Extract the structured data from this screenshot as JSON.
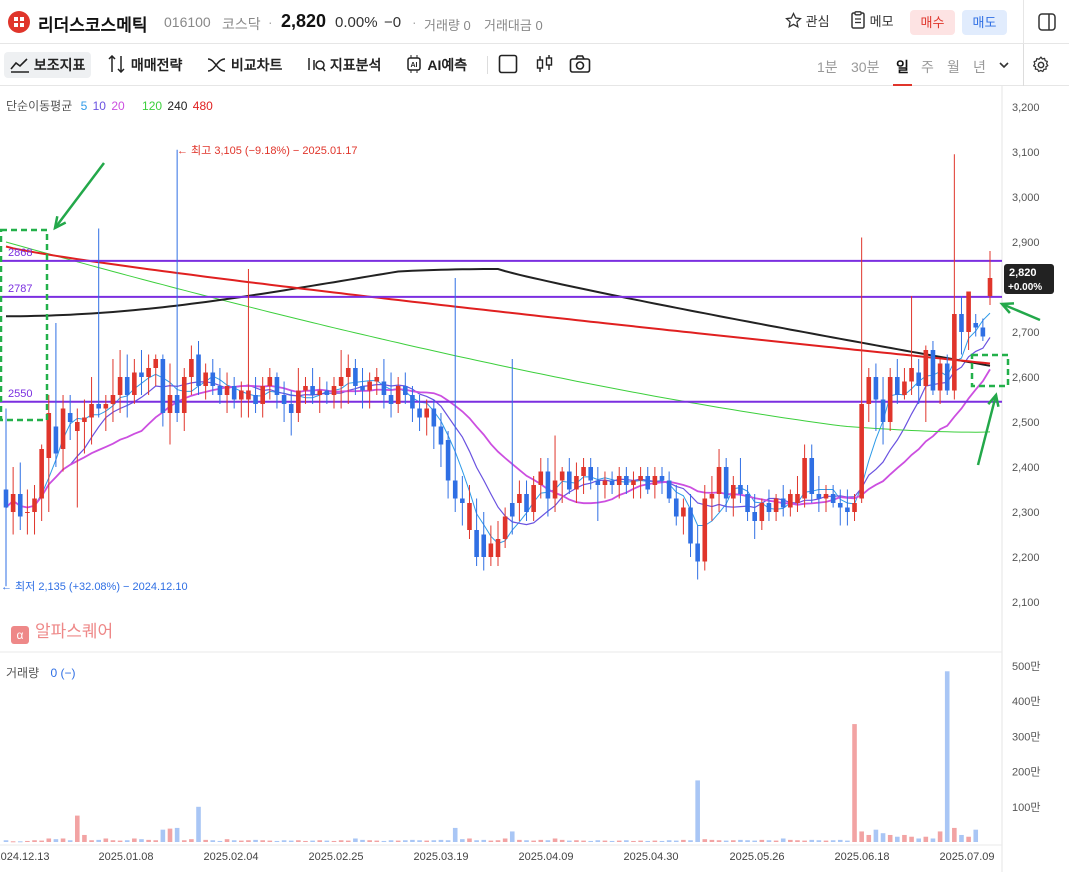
{
  "header": {
    "name": "리더스코스메틱",
    "code": "016100",
    "market": "코스닥",
    "price": "2,820",
    "change_pct": "0.00%",
    "change_abs": "−0",
    "volume": "거래량 0",
    "amount": "거래대금 0",
    "watch_label": "관심",
    "memo_label": "메모",
    "buy_label": "매수",
    "sell_label": "매도"
  },
  "toolbar": {
    "indicators": "보조지표",
    "strategy": "매매전략",
    "compare": "비교차트",
    "analysis": "지표분석",
    "ai": "AI예측",
    "periods": [
      "1분",
      "30분",
      "일",
      "주",
      "월",
      "년"
    ],
    "active_period": "일"
  },
  "legend": {
    "ma_title": "단순이동평균",
    "ma_periods": [
      "5",
      "10",
      "20",
      "120",
      "240",
      "480"
    ],
    "ma_colors": [
      "#2f9be8",
      "#6a52e0",
      "#cc4fe0",
      "#3ccf3c",
      "#222222",
      "#e02020"
    ],
    "volume_title": "거래량",
    "volume_value": "0 (−)"
  },
  "watermark": "알파스퀘어",
  "chart_data": {
    "type": "candlestick",
    "x_labels": [
      "2024.12.13",
      "2025.01.08",
      "2025.02.04",
      "2025.02.25",
      "2025.03.19",
      "2025.04.09",
      "2025.04.30",
      "2025.05.26",
      "2025.06.18",
      "2025.07.09"
    ],
    "y_ticks": [
      "3,200",
      "3,100",
      "3,000",
      "2,900",
      "2,800",
      "2,700",
      "2,600",
      "2,500",
      "2,400",
      "2,300",
      "2,200",
      "2,100"
    ],
    "ylim": [
      2060,
      3220
    ],
    "volume_ticks": [
      "500만",
      "400만",
      "300만",
      "200만",
      "100만"
    ],
    "horizontal_lines": [
      {
        "label": "2868",
        "value": 2858,
        "color": "#7b2fe0"
      },
      {
        "label": "2787",
        "value": 2778,
        "color": "#7b2fe0"
      },
      {
        "label": "2550",
        "value": 2545,
        "color": "#7b2fe0"
      }
    ],
    "high_annotation": "← 최고 3,105 (−9.18%) − 2025.01.17",
    "low_annotation": "← 최저 2,135 (+32.08%) − 2024.12.10",
    "last_price_label": "2,820",
    "last_change_label": "+0.00%",
    "candles": [
      {
        "o": 2350,
        "h": 2530,
        "l": 2135,
        "c": 2310,
        "up": false
      },
      {
        "o": 2300,
        "h": 2400,
        "l": 2250,
        "c": 2340,
        "up": true
      },
      {
        "o": 2340,
        "h": 2410,
        "l": 2260,
        "c": 2290,
        "up": false
      },
      {
        "o": 2300,
        "h": 2350,
        "l": 2250,
        "c": 2300,
        "up": true
      },
      {
        "o": 2300,
        "h": 2360,
        "l": 2250,
        "c": 2330,
        "up": true
      },
      {
        "o": 2330,
        "h": 2450,
        "l": 2280,
        "c": 2440,
        "up": true
      },
      {
        "o": 2420,
        "h": 2560,
        "l": 2300,
        "c": 2520,
        "up": true
      },
      {
        "o": 2430,
        "h": 2720,
        "l": 2400,
        "c": 2490,
        "up": false
      },
      {
        "o": 2440,
        "h": 2560,
        "l": 2390,
        "c": 2530,
        "up": true
      },
      {
        "o": 2520,
        "h": 2560,
        "l": 2460,
        "c": 2500,
        "up": false
      },
      {
        "o": 2480,
        "h": 2530,
        "l": 2310,
        "c": 2500,
        "up": true
      },
      {
        "o": 2500,
        "h": 2550,
        "l": 2430,
        "c": 2510,
        "up": true
      },
      {
        "o": 2510,
        "h": 2600,
        "l": 2450,
        "c": 2540,
        "up": true
      },
      {
        "o": 2540,
        "h": 2930,
        "l": 2510,
        "c": 2530,
        "up": false
      },
      {
        "o": 2530,
        "h": 2560,
        "l": 2480,
        "c": 2540,
        "up": true
      },
      {
        "o": 2540,
        "h": 2640,
        "l": 2500,
        "c": 2560,
        "up": true
      },
      {
        "o": 2560,
        "h": 2660,
        "l": 2520,
        "c": 2600,
        "up": true
      },
      {
        "o": 2600,
        "h": 2650,
        "l": 2510,
        "c": 2560,
        "up": false
      },
      {
        "o": 2560,
        "h": 2640,
        "l": 2540,
        "c": 2610,
        "up": true
      },
      {
        "o": 2610,
        "h": 2660,
        "l": 2560,
        "c": 2600,
        "up": false
      },
      {
        "o": 2600,
        "h": 2650,
        "l": 2560,
        "c": 2620,
        "up": true
      },
      {
        "o": 2620,
        "h": 2650,
        "l": 2580,
        "c": 2640,
        "up": true
      },
      {
        "o": 2640,
        "h": 2650,
        "l": 2490,
        "c": 2520,
        "up": false
      },
      {
        "o": 2520,
        "h": 2630,
        "l": 2450,
        "c": 2560,
        "up": true
      },
      {
        "o": 2560,
        "h": 3105,
        "l": 2500,
        "c": 2520,
        "up": false
      },
      {
        "o": 2520,
        "h": 2620,
        "l": 2480,
        "c": 2600,
        "up": true
      },
      {
        "o": 2600,
        "h": 2670,
        "l": 2560,
        "c": 2640,
        "up": true
      },
      {
        "o": 2650,
        "h": 2680,
        "l": 2560,
        "c": 2580,
        "up": false
      },
      {
        "o": 2580,
        "h": 2630,
        "l": 2550,
        "c": 2610,
        "up": true
      },
      {
        "o": 2610,
        "h": 2640,
        "l": 2560,
        "c": 2580,
        "up": false
      },
      {
        "o": 2580,
        "h": 2620,
        "l": 2540,
        "c": 2560,
        "up": false
      },
      {
        "o": 2560,
        "h": 2610,
        "l": 2520,
        "c": 2580,
        "up": true
      },
      {
        "o": 2580,
        "h": 2600,
        "l": 2530,
        "c": 2550,
        "up": false
      },
      {
        "o": 2550,
        "h": 2590,
        "l": 2510,
        "c": 2570,
        "up": true
      },
      {
        "o": 2570,
        "h": 2840,
        "l": 2510,
        "c": 2550,
        "up": true
      },
      {
        "o": 2560,
        "h": 2600,
        "l": 2520,
        "c": 2540,
        "up": false
      },
      {
        "o": 2540,
        "h": 2600,
        "l": 2510,
        "c": 2580,
        "up": true
      },
      {
        "o": 2580,
        "h": 2620,
        "l": 2550,
        "c": 2600,
        "up": true
      },
      {
        "o": 2600,
        "h": 2610,
        "l": 2530,
        "c": 2560,
        "up": false
      },
      {
        "o": 2560,
        "h": 2590,
        "l": 2500,
        "c": 2540,
        "up": false
      },
      {
        "o": 2540,
        "h": 2570,
        "l": 2470,
        "c": 2520,
        "up": false
      },
      {
        "o": 2520,
        "h": 2620,
        "l": 2500,
        "c": 2570,
        "up": true
      },
      {
        "o": 2570,
        "h": 2600,
        "l": 2540,
        "c": 2580,
        "up": true
      },
      {
        "o": 2580,
        "h": 2620,
        "l": 2540,
        "c": 2560,
        "up": false
      },
      {
        "o": 2560,
        "h": 2600,
        "l": 2520,
        "c": 2570,
        "up": true
      },
      {
        "o": 2570,
        "h": 2590,
        "l": 2540,
        "c": 2560,
        "up": false
      },
      {
        "o": 2560,
        "h": 2600,
        "l": 2530,
        "c": 2580,
        "up": true
      },
      {
        "o": 2580,
        "h": 2660,
        "l": 2530,
        "c": 2600,
        "up": true
      },
      {
        "o": 2600,
        "h": 2650,
        "l": 2540,
        "c": 2620,
        "up": true
      },
      {
        "o": 2620,
        "h": 2640,
        "l": 2560,
        "c": 2580,
        "up": false
      },
      {
        "o": 2580,
        "h": 2620,
        "l": 2530,
        "c": 2570,
        "up": false
      },
      {
        "o": 2570,
        "h": 2610,
        "l": 2530,
        "c": 2590,
        "up": true
      },
      {
        "o": 2590,
        "h": 2620,
        "l": 2560,
        "c": 2600,
        "up": true
      },
      {
        "o": 2590,
        "h": 2640,
        "l": 2530,
        "c": 2560,
        "up": false
      },
      {
        "o": 2560,
        "h": 2610,
        "l": 2510,
        "c": 2540,
        "up": false
      },
      {
        "o": 2540,
        "h": 2600,
        "l": 2520,
        "c": 2580,
        "up": true
      },
      {
        "o": 2580,
        "h": 2610,
        "l": 2540,
        "c": 2560,
        "up": false
      },
      {
        "o": 2560,
        "h": 2580,
        "l": 2500,
        "c": 2530,
        "up": false
      },
      {
        "o": 2530,
        "h": 2560,
        "l": 2480,
        "c": 2510,
        "up": false
      },
      {
        "o": 2510,
        "h": 2550,
        "l": 2470,
        "c": 2530,
        "up": true
      },
      {
        "o": 2530,
        "h": 2550,
        "l": 2440,
        "c": 2490,
        "up": false
      },
      {
        "o": 2490,
        "h": 2520,
        "l": 2400,
        "c": 2450,
        "up": false
      },
      {
        "o": 2460,
        "h": 2480,
        "l": 2330,
        "c": 2370,
        "up": false
      },
      {
        "o": 2370,
        "h": 2820,
        "l": 2300,
        "c": 2330,
        "up": false
      },
      {
        "o": 2330,
        "h": 2380,
        "l": 2270,
        "c": 2320,
        "up": false
      },
      {
        "o": 2320,
        "h": 2360,
        "l": 2240,
        "c": 2260,
        "up": true
      },
      {
        "o": 2260,
        "h": 2330,
        "l": 2180,
        "c": 2200,
        "up": false
      },
      {
        "o": 2200,
        "h": 2300,
        "l": 2170,
        "c": 2250,
        "up": false
      },
      {
        "o": 2230,
        "h": 2270,
        "l": 2180,
        "c": 2200,
        "up": true
      },
      {
        "o": 2200,
        "h": 2280,
        "l": 2180,
        "c": 2240,
        "up": true
      },
      {
        "o": 2240,
        "h": 2310,
        "l": 2220,
        "c": 2290,
        "up": true
      },
      {
        "o": 2290,
        "h": 2640,
        "l": 2250,
        "c": 2320,
        "up": false
      },
      {
        "o": 2320,
        "h": 2370,
        "l": 2280,
        "c": 2340,
        "up": true
      },
      {
        "o": 2340,
        "h": 2370,
        "l": 2280,
        "c": 2300,
        "up": false
      },
      {
        "o": 2300,
        "h": 2380,
        "l": 2280,
        "c": 2360,
        "up": true
      },
      {
        "o": 2360,
        "h": 2420,
        "l": 2330,
        "c": 2390,
        "up": true
      },
      {
        "o": 2390,
        "h": 2420,
        "l": 2290,
        "c": 2330,
        "up": false
      },
      {
        "o": 2330,
        "h": 2470,
        "l": 2300,
        "c": 2370,
        "up": true
      },
      {
        "o": 2370,
        "h": 2400,
        "l": 2320,
        "c": 2390,
        "up": true
      },
      {
        "o": 2390,
        "h": 2420,
        "l": 2340,
        "c": 2350,
        "up": false
      },
      {
        "o": 2350,
        "h": 2410,
        "l": 2320,
        "c": 2380,
        "up": true
      },
      {
        "o": 2380,
        "h": 2420,
        "l": 2340,
        "c": 2400,
        "up": true
      },
      {
        "o": 2400,
        "h": 2420,
        "l": 2350,
        "c": 2370,
        "up": false
      },
      {
        "o": 2370,
        "h": 2400,
        "l": 2280,
        "c": 2360,
        "up": false
      },
      {
        "o": 2360,
        "h": 2390,
        "l": 2330,
        "c": 2370,
        "up": true
      },
      {
        "o": 2370,
        "h": 2390,
        "l": 2340,
        "c": 2360,
        "up": false
      },
      {
        "o": 2360,
        "h": 2400,
        "l": 2330,
        "c": 2380,
        "up": true
      },
      {
        "o": 2380,
        "h": 2400,
        "l": 2340,
        "c": 2360,
        "up": false
      },
      {
        "o": 2360,
        "h": 2390,
        "l": 2330,
        "c": 2370,
        "up": true
      },
      {
        "o": 2370,
        "h": 2400,
        "l": 2330,
        "c": 2380,
        "up": true
      },
      {
        "o": 2380,
        "h": 2400,
        "l": 2340,
        "c": 2350,
        "up": false
      },
      {
        "o": 2360,
        "h": 2400,
        "l": 2330,
        "c": 2380,
        "up": true
      },
      {
        "o": 2380,
        "h": 2400,
        "l": 2340,
        "c": 2370,
        "up": false
      },
      {
        "o": 2370,
        "h": 2390,
        "l": 2320,
        "c": 2330,
        "up": false
      },
      {
        "o": 2330,
        "h": 2360,
        "l": 2270,
        "c": 2290,
        "up": false
      },
      {
        "o": 2290,
        "h": 2330,
        "l": 2250,
        "c": 2310,
        "up": true
      },
      {
        "o": 2310,
        "h": 2340,
        "l": 2200,
        "c": 2230,
        "up": false
      },
      {
        "o": 2230,
        "h": 2270,
        "l": 2150,
        "c": 2190,
        "up": false
      },
      {
        "o": 2190,
        "h": 2360,
        "l": 2170,
        "c": 2330,
        "up": true
      },
      {
        "o": 2330,
        "h": 2380,
        "l": 2280,
        "c": 2340,
        "up": true
      },
      {
        "o": 2340,
        "h": 2440,
        "l": 2300,
        "c": 2400,
        "up": true
      },
      {
        "o": 2400,
        "h": 2420,
        "l": 2300,
        "c": 2330,
        "up": false
      },
      {
        "o": 2330,
        "h": 2380,
        "l": 2290,
        "c": 2360,
        "up": true
      },
      {
        "o": 2360,
        "h": 2420,
        "l": 2320,
        "c": 2340,
        "up": false
      },
      {
        "o": 2340,
        "h": 2360,
        "l": 2280,
        "c": 2300,
        "up": false
      },
      {
        "o": 2300,
        "h": 2340,
        "l": 2240,
        "c": 2280,
        "up": false
      },
      {
        "o": 2280,
        "h": 2330,
        "l": 2260,
        "c": 2320,
        "up": true
      },
      {
        "o": 2320,
        "h": 2350,
        "l": 2280,
        "c": 2300,
        "up": false
      },
      {
        "o": 2300,
        "h": 2340,
        "l": 2280,
        "c": 2330,
        "up": true
      },
      {
        "o": 2330,
        "h": 2360,
        "l": 2290,
        "c": 2310,
        "up": false
      },
      {
        "o": 2310,
        "h": 2350,
        "l": 2290,
        "c": 2340,
        "up": true
      },
      {
        "o": 2340,
        "h": 2380,
        "l": 2300,
        "c": 2320,
        "up": true
      },
      {
        "o": 2330,
        "h": 2450,
        "l": 2310,
        "c": 2420,
        "up": true
      },
      {
        "o": 2420,
        "h": 2450,
        "l": 2320,
        "c": 2340,
        "up": false
      },
      {
        "o": 2340,
        "h": 2380,
        "l": 2300,
        "c": 2330,
        "up": false
      },
      {
        "o": 2330,
        "h": 2360,
        "l": 2300,
        "c": 2340,
        "up": true
      },
      {
        "o": 2340,
        "h": 2360,
        "l": 2310,
        "c": 2320,
        "up": false
      },
      {
        "o": 2320,
        "h": 2350,
        "l": 2270,
        "c": 2310,
        "up": false
      },
      {
        "o": 2310,
        "h": 2350,
        "l": 2270,
        "c": 2300,
        "up": false
      },
      {
        "o": 2300,
        "h": 2340,
        "l": 2280,
        "c": 2320,
        "up": true
      },
      {
        "o": 2330,
        "h": 2910,
        "l": 2320,
        "c": 2540,
        "up": true
      },
      {
        "o": 2540,
        "h": 2620,
        "l": 2500,
        "c": 2600,
        "up": true
      },
      {
        "o": 2600,
        "h": 2630,
        "l": 2480,
        "c": 2550,
        "up": false
      },
      {
        "o": 2550,
        "h": 2600,
        "l": 2450,
        "c": 2500,
        "up": false
      },
      {
        "o": 2500,
        "h": 2620,
        "l": 2480,
        "c": 2600,
        "up": true
      },
      {
        "o": 2600,
        "h": 2640,
        "l": 2540,
        "c": 2560,
        "up": false
      },
      {
        "o": 2560,
        "h": 2620,
        "l": 2550,
        "c": 2590,
        "up": true
      },
      {
        "o": 2590,
        "h": 2780,
        "l": 2560,
        "c": 2620,
        "up": true
      },
      {
        "o": 2610,
        "h": 2640,
        "l": 2540,
        "c": 2580,
        "up": false
      },
      {
        "o": 2580,
        "h": 2670,
        "l": 2500,
        "c": 2660,
        "up": true
      },
      {
        "o": 2660,
        "h": 2680,
        "l": 2560,
        "c": 2570,
        "up": false
      },
      {
        "o": 2570,
        "h": 2640,
        "l": 2540,
        "c": 2630,
        "up": true
      },
      {
        "o": 2630,
        "h": 2650,
        "l": 2560,
        "c": 2570,
        "up": false
      },
      {
        "o": 2570,
        "h": 3095,
        "l": 2550,
        "c": 2740,
        "up": true
      },
      {
        "o": 2740,
        "h": 2780,
        "l": 2650,
        "c": 2700,
        "up": false
      },
      {
        "o": 2700,
        "h": 2790,
        "l": 2660,
        "c": 2790,
        "up": true
      },
      {
        "o": 2720,
        "h": 2740,
        "l": 2690,
        "c": 2710,
        "up": false
      },
      {
        "o": 2710,
        "h": 2730,
        "l": 2680,
        "c": 2690,
        "up": false
      },
      {
        "o": 2780,
        "h": 2880,
        "l": 2760,
        "c": 2820,
        "up": true
      }
    ],
    "volumes": [
      0.05,
      0.02,
      0.02,
      0.03,
      0.05,
      0.04,
      0.1,
      0.08,
      0.1,
      0.05,
      0.75,
      0.2,
      0.05,
      0.06,
      0.1,
      0.05,
      0.04,
      0.05,
      0.1,
      0.08,
      0.06,
      0.05,
      0.35,
      0.38,
      0.4,
      0.05,
      0.08,
      1.0,
      0.06,
      0.05,
      0.03,
      0.08,
      0.05,
      0.04,
      0.05,
      0.06,
      0.05,
      0.04,
      0.03,
      0.05,
      0.04,
      0.05,
      0.03,
      0.04,
      0.05,
      0.04,
      0.03,
      0.05,
      0.04,
      0.1,
      0.06,
      0.05,
      0.04,
      0.03,
      0.05,
      0.04,
      0.05,
      0.06,
      0.05,
      0.04,
      0.05,
      0.06,
      0.05,
      0.4,
      0.08,
      0.1,
      0.05,
      0.06,
      0.04,
      0.05,
      0.1,
      0.3,
      0.06,
      0.05,
      0.04,
      0.06,
      0.05,
      0.1,
      0.06,
      0.04,
      0.05,
      0.04,
      0.03,
      0.05,
      0.04,
      0.03,
      0.04,
      0.05,
      0.03,
      0.04,
      0.03,
      0.04,
      0.03,
      0.05,
      0.04,
      0.06,
      0.05,
      1.75,
      0.08,
      0.06,
      0.05,
      0.04,
      0.05,
      0.06,
      0.05,
      0.04,
      0.06,
      0.05,
      0.04,
      0.1,
      0.06,
      0.05,
      0.04,
      0.06,
      0.05,
      0.04,
      0.05,
      0.06,
      0.04,
      3.35,
      0.3,
      0.2,
      0.35,
      0.25,
      0.2,
      0.15,
      0.2,
      0.15,
      0.1,
      0.15,
      0.1,
      0.3,
      4.85,
      0.4,
      0.2,
      0.15,
      0.35
    ]
  }
}
